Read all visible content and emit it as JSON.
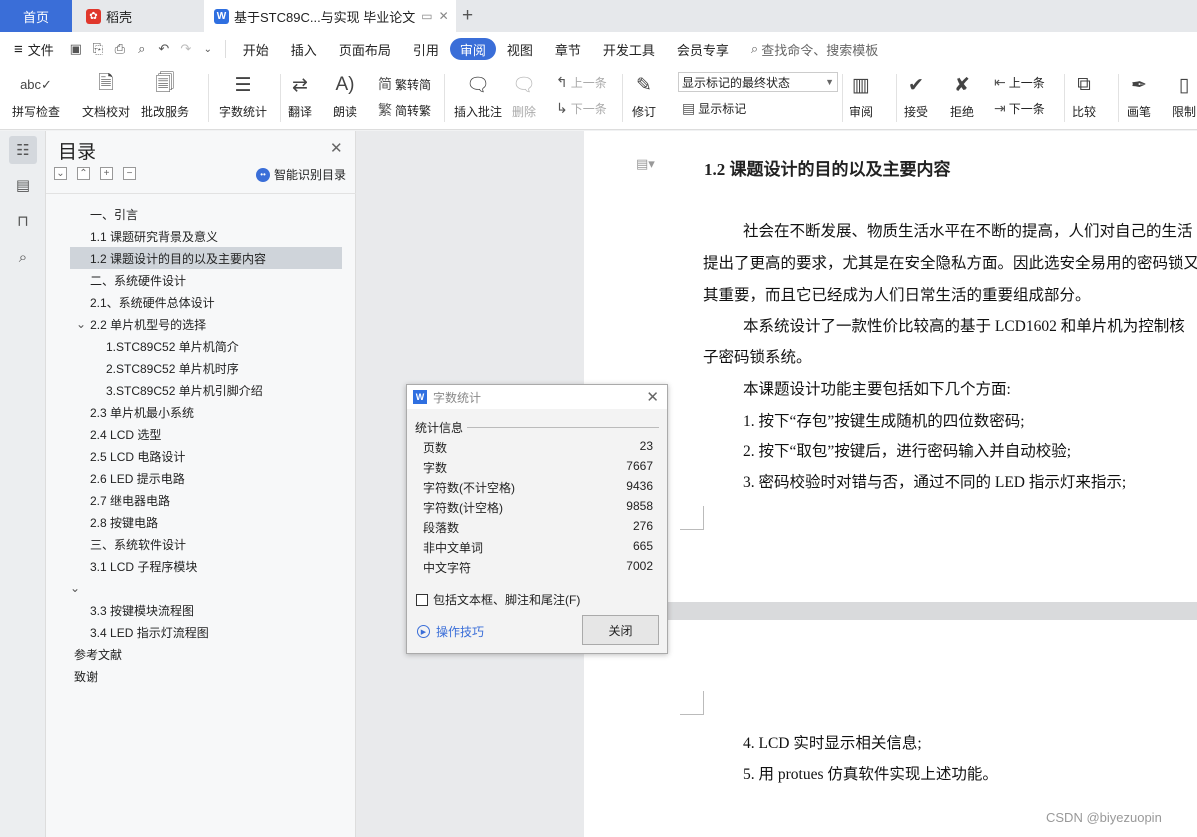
{
  "tabs": {
    "home": "首页",
    "daoke": "稻壳",
    "doc": "基于STC89C...与实现 毕业论文"
  },
  "menu": {
    "file": "文件",
    "items": [
      "开始",
      "插入",
      "页面布局",
      "引用",
      "审阅",
      "视图",
      "章节",
      "开发工具",
      "会员专享"
    ],
    "active": "审阅",
    "search": "查找命令、搜索模板"
  },
  "ribbon": {
    "spell": "拼写检查",
    "proof": "文档校对",
    "approve": "批改服务",
    "count": "字数统计",
    "translate": "翻译",
    "read": "朗读",
    "trad": "繁转简",
    "simp": "简转繁",
    "insert_comment": "插入批注",
    "delete": "删除",
    "prev": "上一条",
    "next": "下一条",
    "revise": "修订",
    "markup_state": "显示标记的最终状态",
    "show_markup": "显示标记",
    "review": "审阅",
    "accept": "接受",
    "reject": "拒绝",
    "prev2": "上一条",
    "next2": "下一条",
    "compare": "比较",
    "pen": "画笔",
    "restrict": "限制"
  },
  "toc": {
    "title": "目录",
    "smart": "智能识别目录",
    "items": [
      {
        "t": "一、引言"
      },
      {
        "t": "1.1 课题研究背景及意义"
      },
      {
        "t": "1.2 课题设计的目的以及主要内容"
      },
      {
        "t": "二、系统硬件设计"
      },
      {
        "t": "2.1、系统硬件总体设计"
      },
      {
        "t": "2.2 单片机型号的选择"
      },
      {
        "t": "1.STC89C52 单片机简介"
      },
      {
        "t": "2.STC89C52 单片机时序"
      },
      {
        "t": "3.STC89C52 单片机引脚介绍"
      },
      {
        "t": "2.3 单片机最小系统"
      },
      {
        "t": "2.4 LCD 选型"
      },
      {
        "t": "2.5 LCD 电路设计"
      },
      {
        "t": "2.6 LED 提示电路"
      },
      {
        "t": "2.7 继电器电路"
      },
      {
        "t": "2.8 按键电路"
      },
      {
        "t": "三、系统软件设计"
      },
      {
        "t": "3.1 LCD 子程序模块"
      },
      {
        "t": ""
      },
      {
        "t": "3.3 按键模块流程图"
      },
      {
        "t": "3.4 LED 指示灯流程图"
      },
      {
        "t": "参考文献"
      },
      {
        "t": "致谢"
      }
    ]
  },
  "doc": {
    "heading": "1.2 课题设计的目的以及主要内容",
    "lines": [
      "社会在不断发展、物质生活水平在不断的提高，人们对自己的生活",
      "提出了更高的要求，尤其是在安全隐私方面。因此选安全易用的密码锁又",
      "其重要，而且它已经成为人们日常生活的重要组成部分。",
      "本系统设计了一款性价比较高的基于 LCD1602 和单片机为控制核",
      "子密码锁系统。",
      "本课题设计功能主要包括如下几个方面:",
      "1. 按下“存包”按键生成随机的四位数密码;",
      "2. 按下“取包”按键后，进行密码输入并自动校验;",
      "3. 密码校验时对错与否，通过不同的 LED 指示灯来指示;",
      "4. LCD 实时显示相关信息;",
      "5. 用 protues 仿真软件实现上述功能。"
    ]
  },
  "dialog": {
    "title": "字数统计",
    "section": "统计信息",
    "rows": [
      {
        "k": "页数",
        "v": "23"
      },
      {
        "k": "字数",
        "v": "7667"
      },
      {
        "k": "字符数(不计空格)",
        "v": "9436"
      },
      {
        "k": "字符数(计空格)",
        "v": "9858"
      },
      {
        "k": "段落数",
        "v": "276"
      },
      {
        "k": "非中文单词",
        "v": "665"
      },
      {
        "k": "中文字符",
        "v": "7002"
      }
    ],
    "checkbox": "包括文本框、脚注和尾注(F)",
    "tips": "操作技巧",
    "close": "关闭"
  },
  "watermark": "CSDN @biyezuopin",
  "colors": {
    "accent": "#3a6ed8"
  }
}
